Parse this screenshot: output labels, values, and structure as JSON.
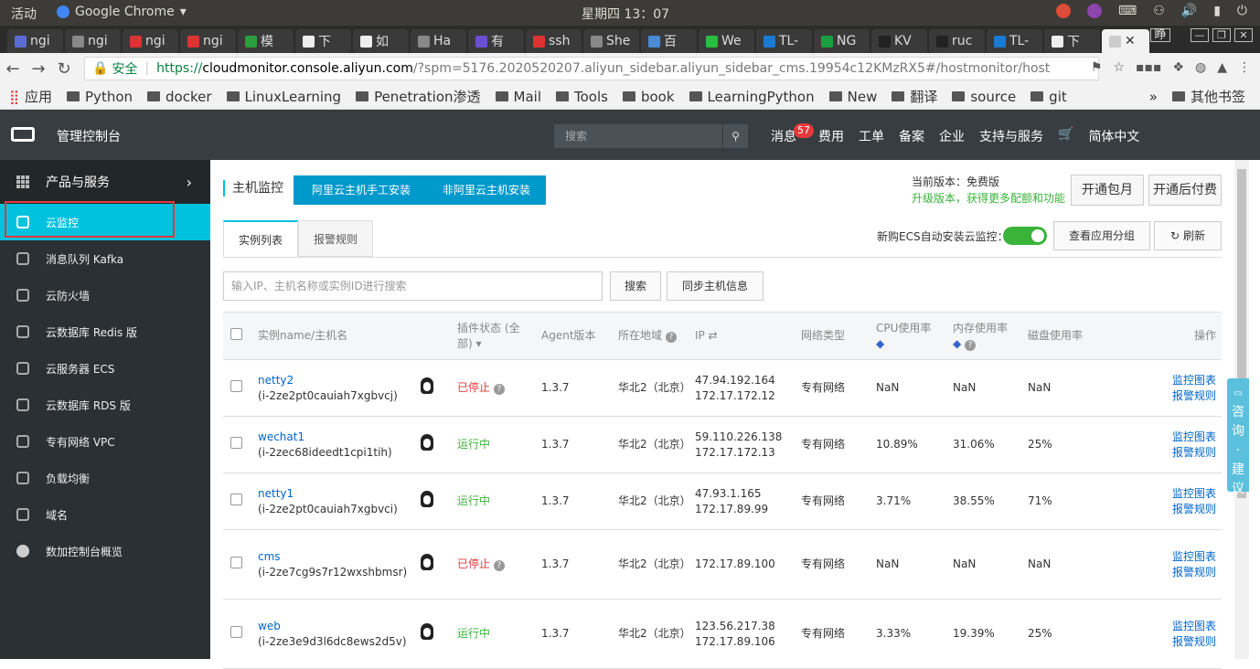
{
  "system": {
    "activities": "活动",
    "app": "Google Chrome",
    "clock": "星期四 13：07"
  },
  "tabs": [
    "ngi",
    "ngi",
    "ngi",
    "ngi",
    "模",
    "下",
    "如",
    "Ha",
    "有",
    "ssh",
    "She",
    "百",
    "We",
    "TL-",
    "NG",
    "KV",
    "ruc",
    "TL-",
    "下"
  ],
  "ime": "睁",
  "address": {
    "secure_label": "安全",
    "scheme": "https://",
    "host": "cloudmonitor.console.aliyun.com",
    "path": "/?spm=5176.2020520207.aliyun_sidebar.aliyun_sidebar_cms.19954c12KMzRX5#/hostmonitor/host"
  },
  "bookmarks": {
    "apps": "应用",
    "items": [
      "Python",
      "docker",
      "LinuxLearning",
      "Penetration渗透",
      "Mail",
      "Tools",
      "book",
      "LearningPython",
      "New",
      "翻译",
      "source",
      "git"
    ],
    "more": "»",
    "other": "其他书签"
  },
  "console": {
    "title": "管理控制台",
    "search_placeholder": "搜索",
    "nav": [
      "消息",
      "费用",
      "工单",
      "备案",
      "企业",
      "支持与服务",
      "简体中文"
    ],
    "msg_count": "57"
  },
  "sidebar": {
    "header": "产品与服务",
    "items": [
      "云监控",
      "消息队列 Kafka",
      "云防火墙",
      "云数据库 Redis 版",
      "云服务器 ECS",
      "云数据库 RDS 版",
      "专有网络 VPC",
      "负载均衡",
      "域名",
      "数加控制台概览"
    ]
  },
  "main": {
    "title": "主机监控",
    "btn_aliyun": "阿里云主机手工安装",
    "btn_non_aliyun": "非阿里云主机安装",
    "version_label": "当前版本：免费版",
    "upgrade": "升级版本，获得更多配额和功能",
    "btn_monthly": "开通包月",
    "btn_postpaid": "开通后付费",
    "tab_instances": "实例列表",
    "tab_alarms": "报警规则",
    "auto_install": "新购ECS自动安装云监控：",
    "btn_group": "查看应用分组",
    "btn_refresh": "刷新",
    "search_placeholder": "输入IP、主机名称或实例ID进行搜索",
    "btn_search": "搜索",
    "btn_sync": "同步主机信息"
  },
  "table": {
    "headers": {
      "name": "实例name/主机名",
      "plugin": "插件状态 (全部)",
      "agent": "Agent版本",
      "region": "所在地域",
      "ip": "IP",
      "network": "网络类型",
      "cpu": "CPU使用率",
      "mem": "内存使用率",
      "disk": "磁盘使用率",
      "ops": "操作"
    },
    "rows": [
      {
        "name": "netty2",
        "id": "(i-2ze2pt0cauiah7xgbvcj)",
        "status": "已停止",
        "agent": "1.3.7",
        "region": "华北2（北京）",
        "ip1": "47.94.192.164",
        "ip2": "172.17.172.12",
        "net": "专有网络",
        "cpu": "NaN",
        "mem": "NaN",
        "disk": "NaN"
      },
      {
        "name": "wechat1",
        "id": "(i-2zec68ideedt1cpi1tih)",
        "status": "运行中",
        "agent": "1.3.7",
        "region": "华北2（北京）",
        "ip1": "59.110.226.138",
        "ip2": "172.17.172.13",
        "net": "专有网络",
        "cpu": "10.89%",
        "mem": "31.06%",
        "disk": "25%"
      },
      {
        "name": "netty1",
        "id": "(i-2ze2pt0cauiah7xgbvci)",
        "status": "运行中",
        "agent": "1.3.7",
        "region": "华北2（北京）",
        "ip1": "47.93.1.165",
        "ip2": "172.17.89.99",
        "net": "专有网络",
        "cpu": "3.71%",
        "mem": "38.55%",
        "disk": "71%"
      },
      {
        "name": "cms",
        "id": "(i-2ze7cg9s7r12wxshbmsr)",
        "status": "已停止",
        "agent": "1.3.7",
        "region": "华北2（北京）",
        "ip1": "",
        "ip2": "172.17.89.100",
        "net": "专有网络",
        "cpu": "NaN",
        "mem": "NaN",
        "disk": "NaN"
      },
      {
        "name": "web",
        "id": "(i-2ze3e9d3l6dc8ews2d5v)",
        "status": "运行中",
        "agent": "1.3.7",
        "region": "华北2（北京）",
        "ip1": "123.56.217.38",
        "ip2": "172.17.89.106",
        "net": "专有网络",
        "cpu": "3.33%",
        "mem": "19.39%",
        "disk": "25%"
      }
    ],
    "op_monitor": "监控图表",
    "op_alarm": "报警规则"
  },
  "consult": "咨询·建议",
  "colors": {
    "accent": "#00c1de",
    "button": "#0099cc",
    "stopped": "#e4393c",
    "running": "#3ab33a"
  }
}
